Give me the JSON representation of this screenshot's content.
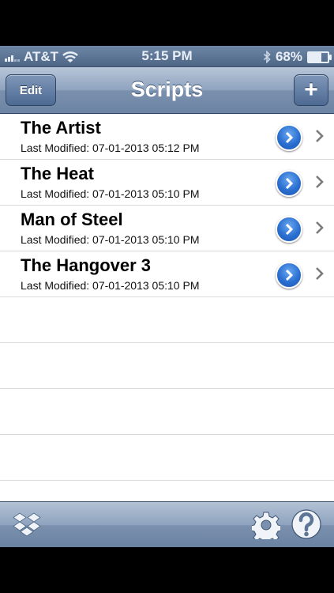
{
  "status_bar": {
    "carrier": "AT&T",
    "time": "5:15 PM",
    "battery_percent": "68%",
    "battery_level": 0.68,
    "icons": [
      "signal-bars-icon",
      "wifi-icon",
      "bluetooth-icon",
      "battery-icon"
    ]
  },
  "nav_bar": {
    "title": "Scripts",
    "edit_label": "Edit",
    "add_label": "+"
  },
  "scripts": [
    {
      "title": "The Artist",
      "modified": "Last Modified: 07-01-2013 05:12 PM"
    },
    {
      "title": "The Heat",
      "modified": "Last Modified: 07-01-2013 05:10 PM"
    },
    {
      "title": "Man of Steel",
      "modified": "Last Modified: 07-01-2013 05:10 PM"
    },
    {
      "title": "The Hangover 3",
      "modified": "Last Modified: 07-01-2013 05:10 PM"
    }
  ],
  "toolbar": {
    "icons": [
      "dropbox-icon",
      "gear-icon",
      "help-icon"
    ]
  },
  "colors": {
    "bar_blue": "#7a90ad",
    "disclosure_blue": "#2a6fd1"
  }
}
